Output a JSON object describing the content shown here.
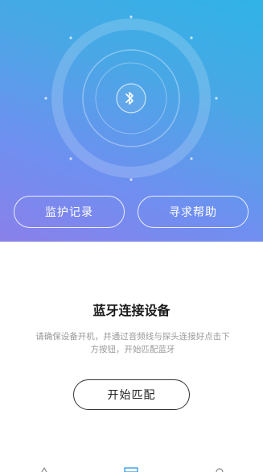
{
  "colors": {
    "hero_gradient_top": "#2fb3e6",
    "hero_gradient_bottom": "#8a80ea",
    "ring_color": "rgba(255,255,255,0.25)",
    "button_border": "#333333"
  },
  "hero": {
    "center_icon": "bluetooth-icon",
    "buttons": {
      "records_label": "监护记录",
      "help_label": "寻求帮助"
    }
  },
  "main": {
    "title": "蓝牙连接设备",
    "description": "请确保设备开机，并通过音频线与探头连接好点击下方按钮，开始匹配蓝牙",
    "start_button_label": "开始匹配"
  },
  "tabbar": {
    "icons": [
      "tab-icon-left",
      "tab-icon-center",
      "tab-icon-right"
    ]
  }
}
